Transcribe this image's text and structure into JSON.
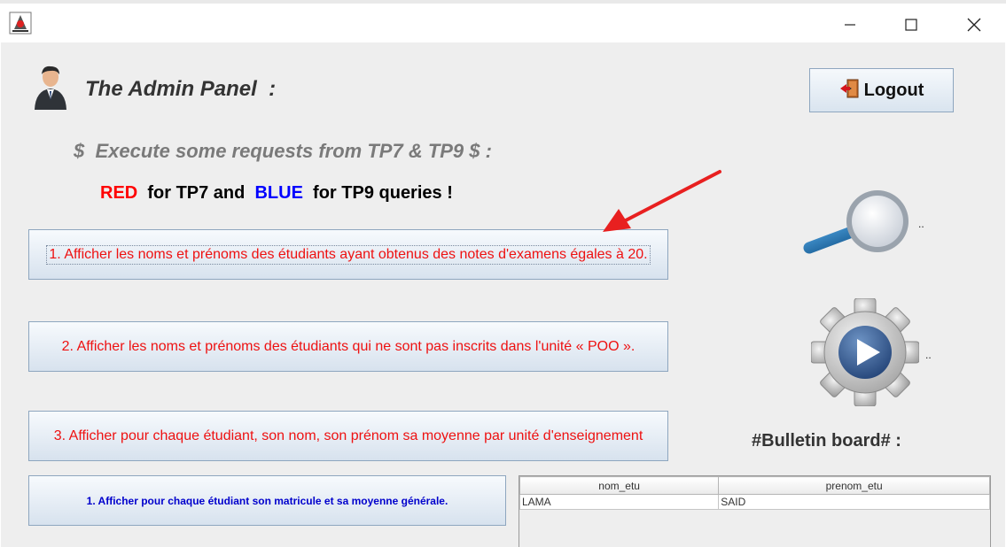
{
  "window": {
    "minimize_glyph": "—",
    "maximize_glyph": "☐",
    "close_glyph": "✕"
  },
  "header": {
    "title": "The Admin Panel  :",
    "logout_label": "Logout"
  },
  "subtitle": "$  Execute some requests from TP7 & TP9 $ :",
  "legend": {
    "red_word": "RED",
    "mid_text": "  for TP7 and  ",
    "blue_word": "BLUE",
    "end_text": "  for TP9 queries !"
  },
  "queries": [
    {
      "label": "1. Afficher les noms et prénoms des étudiants ayant obtenus des notes d'examens égales à 20.",
      "color": "#ee1111"
    },
    {
      "label": "2. Afficher les noms et prénoms des étudiants qui ne sont pas inscrits dans l'unité « POO ».",
      "color": "#ee1111"
    },
    {
      "label": "3. Afficher pour chaque étudiant, son nom, son prénom sa moyenne par unité d'enseignement",
      "color": "#ee1111"
    },
    {
      "label": "1. Afficher pour chaque étudiant son matricule et sa moyenne générale.",
      "color": "#0000cc"
    }
  ],
  "icons": {
    "search_suffix": "..",
    "run_suffix": ".."
  },
  "bulletin": "#Bulletin board# :",
  "table": {
    "columns": [
      "nom_etu",
      "prenom_etu"
    ],
    "rows": [
      [
        "LAMA",
        "SAID"
      ]
    ]
  },
  "colors": {
    "red": "#ff0000",
    "blue": "#0000ff",
    "arrow": "#e82020"
  }
}
